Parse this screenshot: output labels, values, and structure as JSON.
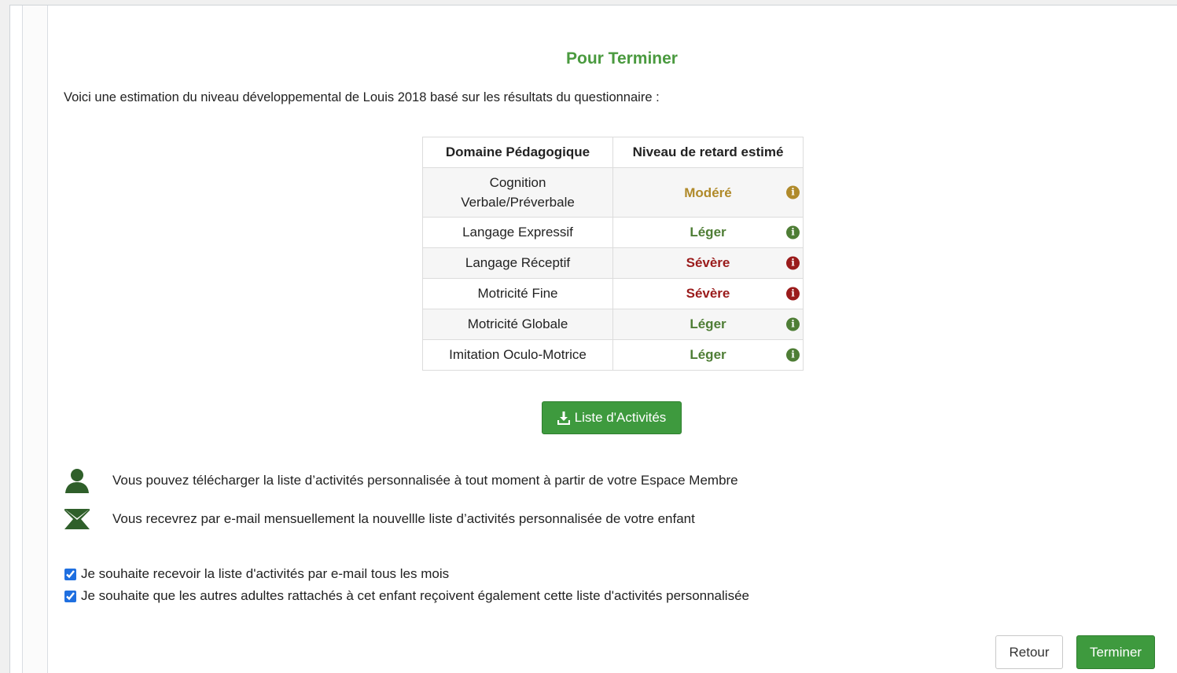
{
  "title": "Pour Terminer",
  "intro": "Voici une estimation du niveau développemental de Louis 2018 basé sur les résultats du questionnaire :",
  "table": {
    "headers": [
      "Domaine Pédagogique",
      "Niveau de retard estimé"
    ],
    "rows": [
      {
        "domain_line1": "Cognition",
        "domain_line2": "Verbale/Préverbale",
        "level": "Modéré",
        "color": "#b08a2a"
      },
      {
        "domain": "Langage Expressif",
        "level": "Léger",
        "color": "#4e7d35"
      },
      {
        "domain": "Langage Réceptif",
        "level": "Sévère",
        "color": "#9a1b1b"
      },
      {
        "domain": "Motricité Fine",
        "level": "Sévère",
        "color": "#9a1b1b"
      },
      {
        "domain": "Motricité Globale",
        "level": "Léger",
        "color": "#4e7d35"
      },
      {
        "domain": "Imitation Oculo-Motrice",
        "level": "Léger",
        "color": "#4e7d35"
      }
    ]
  },
  "download_button": {
    "label": "Liste d'Activités",
    "icon": "download-icon"
  },
  "info": [
    {
      "icon": "user-icon",
      "text": "Vous pouvez télécharger la liste d’activités personnalisée à tout moment à partir de votre Espace Membre"
    },
    {
      "icon": "envelope-icon",
      "text": "Vous recevrez par e-mail mensuellement la nouvellle liste d’activités personnalisée de votre enfant"
    }
  ],
  "checkboxes": [
    {
      "label": "Je souhaite recevoir la liste d'activités par e-mail tous les mois",
      "checked": true
    },
    {
      "label": "Je souhaite que les autres adultes rattachés à cet enfant reçoivent également cette liste d'activités personnalisée",
      "checked": true
    }
  ],
  "buttons": {
    "back": "Retour",
    "finish": "Terminer"
  },
  "colors": {
    "accent": "#3e9a3e",
    "title": "#4a9a3f",
    "moderate": "#b08a2a",
    "mild": "#4e7d35",
    "severe": "#9a1b1b",
    "icon_green": "#2f5f2a"
  }
}
